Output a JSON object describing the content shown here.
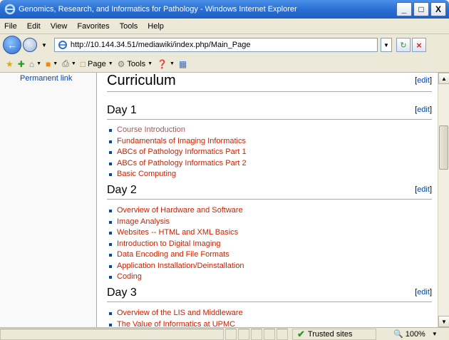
{
  "window": {
    "title": "Genomics, Research, and Informatics for Pathology - Windows Internet Explorer"
  },
  "window_controls": {
    "minimize": "_",
    "maximize": "□",
    "close": "X"
  },
  "menu": [
    "File",
    "Edit",
    "View",
    "Favorites",
    "Tools",
    "Help"
  ],
  "address": {
    "url": "http://10.144.34.51/mediawiki/index.php/Main_Page"
  },
  "toolbar": {
    "page_label": "Page",
    "tools_label": "Tools"
  },
  "sidebar": {
    "permanent_link": "Permanent link"
  },
  "main": {
    "heading": "Curriculum",
    "edit_label": "edit",
    "sections": [
      {
        "title": "Day 1",
        "items": [
          "Course Introduction",
          "Fundamentals of Imaging Informatics",
          "ABCs of Pathology Informatics Part 1",
          "ABCs of Pathology Informatics Part 2",
          "Basic Computing"
        ]
      },
      {
        "title": "Day 2",
        "items": [
          "Overview of Hardware and Software",
          "Image Analysis",
          "Websites -- HTML and XML Basics",
          "Introduction to Digital Imaging",
          "Data Encoding and File Formats",
          "Application Installation/Deinstallation",
          "Coding"
        ]
      },
      {
        "title": "Day 3",
        "items": [
          "Overview of the LIS and Middleware",
          "The Value of Informatics at UPMC"
        ]
      }
    ]
  },
  "status": {
    "zone": "Trusted sites",
    "zoom": "100%"
  }
}
